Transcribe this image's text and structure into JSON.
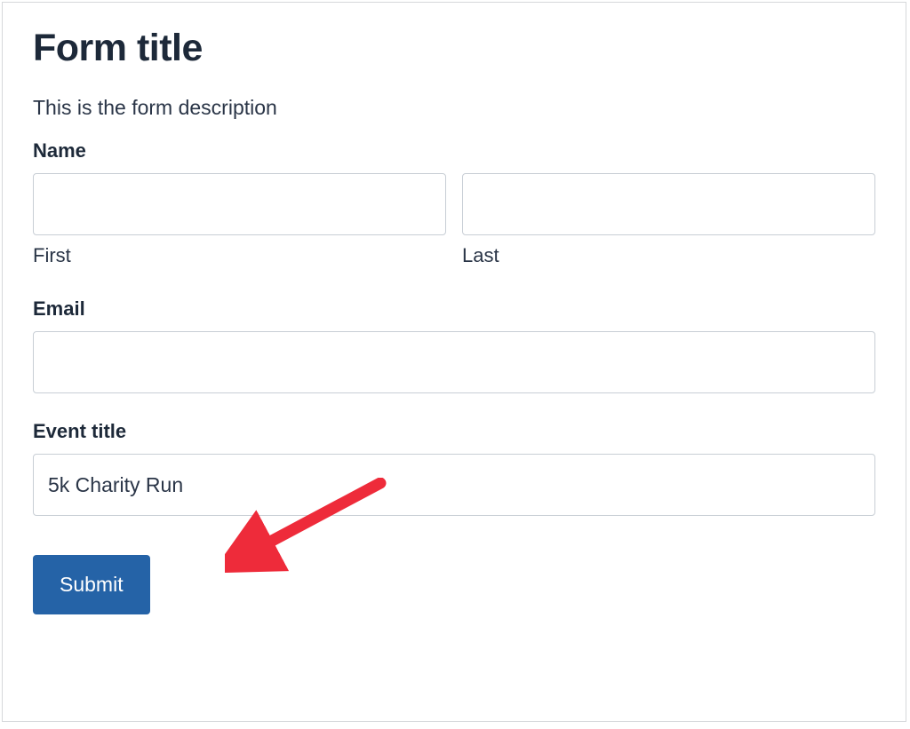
{
  "form": {
    "title": "Form title",
    "description": "This is the form description",
    "fields": {
      "name": {
        "label": "Name",
        "first_sublabel": "First",
        "last_sublabel": "Last",
        "first_value": "",
        "last_value": ""
      },
      "email": {
        "label": "Email",
        "value": ""
      },
      "event_title": {
        "label": "Event title",
        "value": "5k Charity Run"
      }
    },
    "submit_label": "Submit"
  },
  "annotation": {
    "arrow_color": "#ee2b3a"
  }
}
